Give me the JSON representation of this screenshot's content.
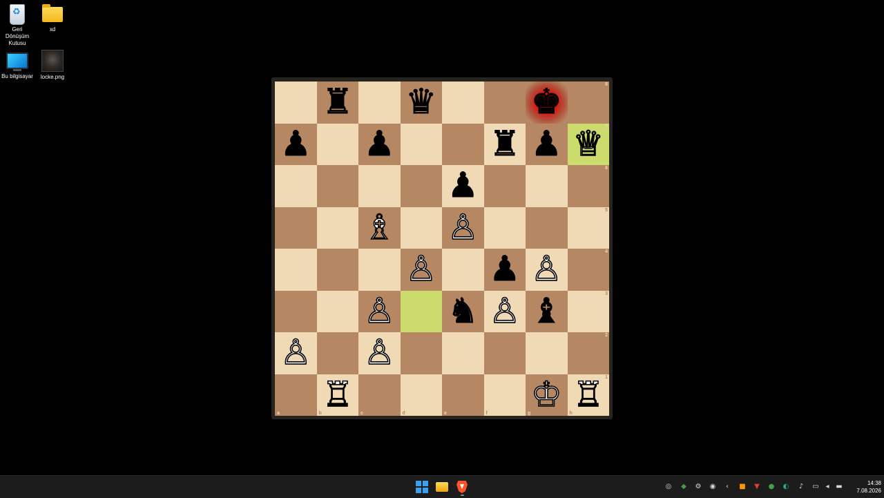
{
  "desktop": {
    "icons": [
      {
        "label": "Geri Dönüşüm Kutusu",
        "icon": "recycle-bin-icon"
      },
      {
        "label": "xd",
        "icon": "folder-icon"
      },
      {
        "label": "Bu bilgisayar",
        "icon": "this-pc-icon"
      },
      {
        "label": "locke.png",
        "icon": "image-file-icon"
      }
    ]
  },
  "chess": {
    "ranks": [
      "8",
      "7",
      "6",
      "5",
      "4",
      "3",
      "2",
      "1"
    ],
    "files": [
      "a",
      "b",
      "c",
      "d",
      "e",
      "f",
      "g",
      "h"
    ],
    "board": [
      [
        "",
        "♜",
        "",
        "♛",
        "",
        "",
        "♚",
        ""
      ],
      [
        "♟",
        "",
        "♟",
        "",
        "",
        "♜",
        "♟",
        "♕"
      ],
      [
        "",
        "",
        "",
        "",
        "♟",
        "",
        "",
        ""
      ],
      [
        "",
        "",
        "♗",
        "",
        "♙",
        "",
        "",
        ""
      ],
      [
        "",
        "",
        "",
        "♙",
        "",
        "♟",
        "♙",
        ""
      ],
      [
        "",
        "",
        "♙",
        "",
        "♞",
        "♙",
        "♝",
        ""
      ],
      [
        "♙",
        "",
        "♙",
        "",
        "",
        "",
        "",
        ""
      ],
      [
        "",
        "♖",
        "",
        "",
        "",
        "",
        "♔",
        "♖"
      ]
    ],
    "piece_colors": [
      [
        "",
        "black",
        "",
        "black",
        "",
        "",
        "black",
        ""
      ],
      [
        "black",
        "",
        "black",
        "",
        "",
        "black",
        "black",
        "white"
      ],
      [
        "",
        "",
        "",
        "",
        "black",
        "",
        "",
        ""
      ],
      [
        "",
        "",
        "white",
        "",
        "white",
        "",
        "",
        ""
      ],
      [
        "",
        "",
        "",
        "white",
        "",
        "black",
        "white",
        ""
      ],
      [
        "",
        "",
        "white",
        "",
        "black",
        "white",
        "black",
        ""
      ],
      [
        "white",
        "",
        "white",
        "",
        "",
        "",
        "",
        ""
      ],
      [
        "",
        "white",
        "",
        "",
        "",
        "",
        "white",
        "white"
      ]
    ],
    "last_move": [
      "d3",
      "h7"
    ],
    "in_check": "g8",
    "colors": {
      "light": "#f0d9b5",
      "dark": "#b58863",
      "highlight": "#cbdb6c",
      "check": "#ff0000"
    }
  },
  "taskbar": {
    "apps": [
      {
        "name": "start",
        "icon": "windows-start-icon"
      },
      {
        "name": "file-explorer",
        "icon": "file-explorer-icon"
      },
      {
        "name": "brave",
        "icon": "brave-browser-icon"
      }
    ],
    "tray_icons": [
      "nvidia-icon",
      "shield-icon",
      "settings-icon",
      "discord-icon",
      "chevron-left-icon",
      "app-icon",
      "app-icon",
      "app-icon",
      "edge-icon",
      "microphone-icon",
      "network-icon",
      "volume-icon",
      "battery-icon"
    ],
    "time": "14:38",
    "date": "7.08.2026"
  }
}
